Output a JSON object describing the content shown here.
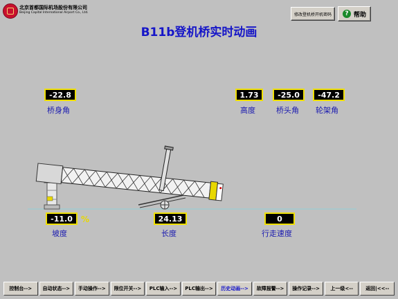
{
  "logo": {
    "cn": "北京首都国际机场股份有限公司",
    "en": "Beijing Capital International Airport Co., Ltd."
  },
  "header": {
    "password_button": "修改登机桥开机密码",
    "help_button": "帮助"
  },
  "title": "B11b登机桥实时动画",
  "readouts": {
    "bridge_angle": {
      "value": "-22.8",
      "label": "桥身角"
    },
    "height": {
      "value": "1.73",
      "label": "高度"
    },
    "head_angle": {
      "value": "-25.0",
      "label": "桥头角"
    },
    "wheel_angle": {
      "value": "-47.2",
      "label": "轮架角"
    },
    "slope": {
      "value": "-11.0",
      "label": "坡度",
      "unit": "%"
    },
    "length": {
      "value": "24.13",
      "label": "长度"
    },
    "travel_speed": {
      "value": "0",
      "label": "行走速度"
    }
  },
  "toolbar": {
    "items": [
      "控制台-->",
      "自动状态-->",
      "手动操作-->",
      "限位开关-->",
      "PLC输入-->",
      "PLC输出-->",
      "历史动画-->",
      "故障报警-->",
      "操作记录-->",
      "上一级<--",
      "返回|<<--"
    ],
    "active_index": 6
  },
  "colors": {
    "background": "#c0c0c0",
    "title": "#1515c8",
    "label": "#1a1ab0",
    "readout_border": "#f0e000",
    "readout_bg": "#000000",
    "bridge_accent": "#e8d800",
    "ground_line": "#8fd0d8"
  }
}
